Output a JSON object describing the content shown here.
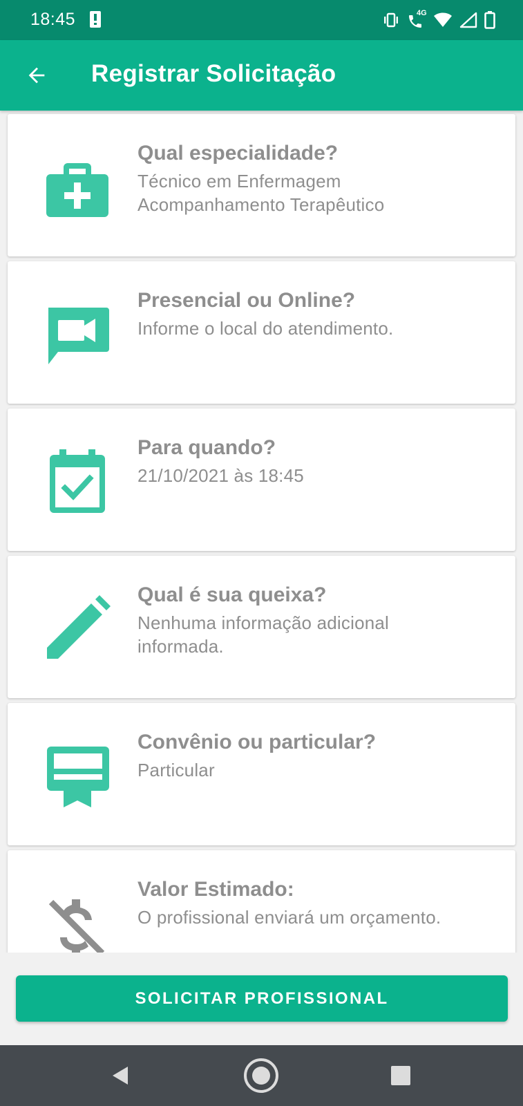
{
  "status_bar": {
    "time": "18:45",
    "network_label": "4G",
    "icons": [
      "alert-icon",
      "vibrate-icon",
      "wifi-calling-icon",
      "wifi-icon",
      "signal-icon",
      "battery-icon"
    ]
  },
  "app_bar": {
    "title": "Registrar Solicitação",
    "back_icon": "arrow-back-icon",
    "background": "#0bb28d",
    "status_background": "#078a6d"
  },
  "cards": [
    {
      "icon": "medical-kit-icon",
      "title": "Qual especialidade?",
      "lines": [
        "Técnico em Enfermagem",
        "Acompanhamento Terapêutico"
      ]
    },
    {
      "icon": "video-chat-icon",
      "title": "Presencial ou Online?",
      "lines": [
        "Informe o local do atendimento."
      ]
    },
    {
      "icon": "calendar-check-icon",
      "title": "Para quando?",
      "lines": [
        "21/10/2021 às 18:45"
      ]
    },
    {
      "icon": "pencil-icon",
      "title": "Qual é sua queixa?",
      "lines": [
        "Nenhuma informação adicional",
        "informada."
      ]
    },
    {
      "icon": "card-membership-icon",
      "title": "Convênio ou particular?",
      "lines": [
        "Particular"
      ]
    },
    {
      "icon": "money-off-icon",
      "title": "Valor Estimado:",
      "lines": [
        "O profissional enviará um orçamento."
      ]
    }
  ],
  "accent_color": "#3cc6a4",
  "primary_button": {
    "label": "SOLICITAR PROFISSIONAL"
  },
  "nav_bar": {
    "icons": [
      "back-triangle-icon",
      "home-circle-icon",
      "recents-square-icon"
    ]
  }
}
